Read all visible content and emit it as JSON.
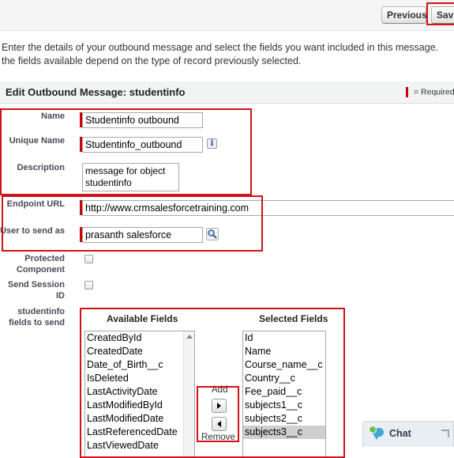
{
  "toolbar": {
    "previous_label": "Previous",
    "save_label": "Save"
  },
  "intro": {
    "line1": "Enter the details of your outbound message and select the fields you want included in this message.",
    "line2": "the fields available depend on the type of record previously selected."
  },
  "section": {
    "title": "Edit Outbound Message: studentinfo",
    "required_legend": "= Required"
  },
  "form": {
    "name_label": "Name",
    "name_value": "Studentinfo outbound",
    "unique_name_label": "Unique Name",
    "unique_name_value": "Studentinfo_outbound",
    "description_label": "Description",
    "description_value": "message for object studentinfo",
    "endpoint_label": "Endpoint URL",
    "endpoint_value": "http://www.crmsalesforcetraining.com",
    "user_label": "User to send as",
    "user_value": "prasanth salesforce",
    "protected_label": "Protected Component",
    "session_label": "Send Session ID",
    "fields_label": "studentinfo fields to send"
  },
  "fields_picker": {
    "available_header": "Available Fields",
    "selected_header": "Selected Fields",
    "add_label": "Add",
    "remove_label": "Remove",
    "available": [
      "CreatedById",
      "CreatedDate",
      "Date_of_Birth__c",
      "IsDeleted",
      "LastActivityDate",
      "LastModifiedById",
      "LastModifiedDate",
      "LastReferencedDate",
      "LastViewedDate"
    ],
    "selected": [
      "Id",
      "Name",
      "Course_name__c",
      "Country__c",
      "Fee_paid__c",
      "subjects1__c",
      "subjects2__c",
      "subjects3__c"
    ],
    "selected_highlight": "subjects3__c"
  },
  "chat": {
    "label": "Chat"
  },
  "icons": {
    "info": "info-icon",
    "lookup": "lookup-magnifier-icon",
    "chat": "chat-bubble-icon"
  },
  "colors": {
    "required": "#c00",
    "annotation": "#d0121a"
  }
}
